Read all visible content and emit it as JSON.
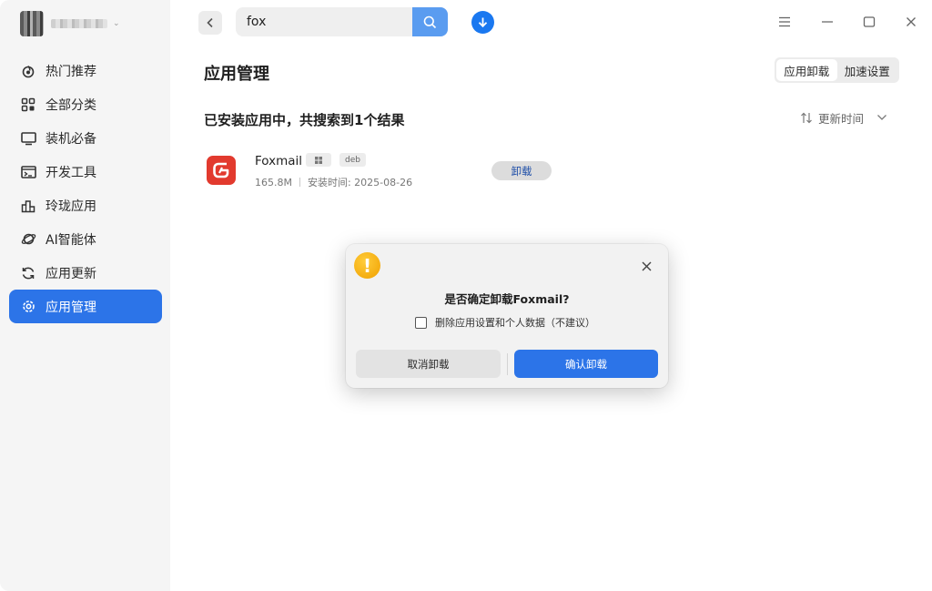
{
  "search": {
    "value": "fox"
  },
  "sidebar": {
    "items": [
      {
        "label": "热门推荐",
        "icon": "hot-icon"
      },
      {
        "label": "全部分类",
        "icon": "grid-icon"
      },
      {
        "label": "装机必备",
        "icon": "monitor-icon"
      },
      {
        "label": "开发工具",
        "icon": "terminal-icon"
      },
      {
        "label": "玲珑应用",
        "icon": "chart-icon"
      },
      {
        "label": "AI智能体",
        "icon": "planet-icon"
      },
      {
        "label": "应用更新",
        "icon": "refresh-icon"
      },
      {
        "label": "应用管理",
        "icon": "gear-icon",
        "active": true
      }
    ]
  },
  "main": {
    "title": "应用管理",
    "segments": [
      "应用卸载",
      "加速设置"
    ],
    "result_title": "已安装应用中，共搜索到1个结果",
    "sort_label": "更新时间",
    "app": {
      "name": "Foxmail",
      "tag_deb": "deb",
      "size": "165.8M",
      "install_date": "安装时间:  2025-08-26",
      "uninstall_label": "卸载"
    }
  },
  "dialog": {
    "title": "是否确定卸载Foxmail?",
    "checkbox_label": "删除应用设置和个人数据（不建议）",
    "cancel_label": "取消卸载",
    "confirm_label": "确认卸载"
  },
  "colors": {
    "accent": "#2c74e8",
    "foxmail_red": "#e23a2e",
    "warning": "#f5a800"
  }
}
